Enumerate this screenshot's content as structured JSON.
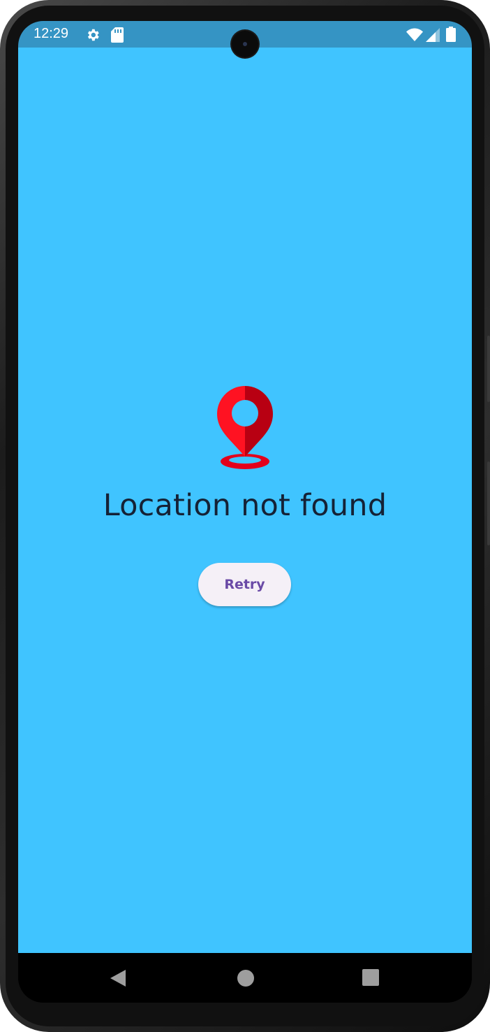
{
  "status_bar": {
    "time": "12:29",
    "background": "#3594c4",
    "icons_left": [
      "gear-icon",
      "sd-card-icon"
    ],
    "icons_right": [
      "wifi-icon",
      "signal-icon",
      "battery-icon"
    ]
  },
  "main": {
    "background": "#40c4ff",
    "icon": "location-pin-icon",
    "message": "Location not found",
    "retry_label": "Retry"
  },
  "nav_bar": {
    "buttons": [
      "back-icon",
      "home-icon",
      "recents-icon"
    ]
  }
}
